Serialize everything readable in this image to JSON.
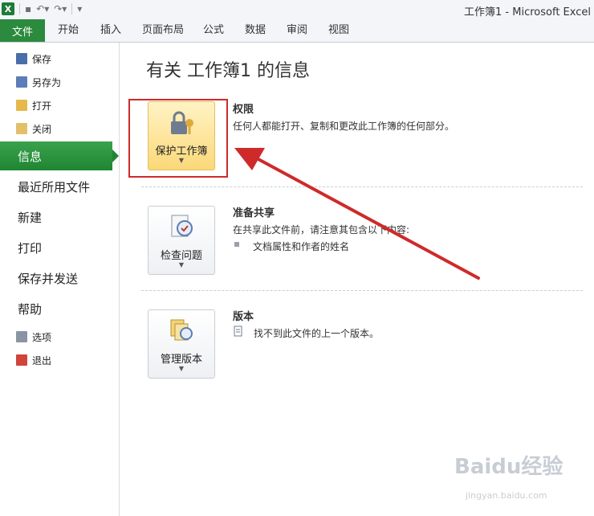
{
  "window": {
    "title": "工作簿1 - Microsoft Excel"
  },
  "ribbon": {
    "file_tab": "文件",
    "tabs": [
      "开始",
      "插入",
      "页面布局",
      "公式",
      "数据",
      "审阅",
      "视图"
    ]
  },
  "sidebar": {
    "small_items": [
      "保存",
      "另存为",
      "打开",
      "关闭"
    ],
    "active": "信息",
    "big_items": [
      "最近所用文件",
      "新建",
      "打印",
      "保存并发送",
      "帮助"
    ],
    "bottom_items": [
      "选项",
      "退出"
    ]
  },
  "main": {
    "title": "有关 工作簿1 的信息",
    "sections": [
      {
        "button": "保护工作簿",
        "title": "权限",
        "text": "任何人都能打开、复制和更改此工作簿的任何部分。"
      },
      {
        "button": "检查问题",
        "title": "准备共享",
        "text": "在共享此文件前，请注意其包含以下内容:",
        "bullet": "文档属性和作者的姓名"
      },
      {
        "button": "管理版本",
        "title": "版本",
        "text": "找不到此文件的上一个版本。"
      }
    ]
  },
  "colors": {
    "accent": "#2b8a3e",
    "annotation": "#cf2a2a",
    "highlight": "#fbd879"
  },
  "watermark": {
    "text": "Baidu经验",
    "sub": "jingyan.baidu.com"
  }
}
